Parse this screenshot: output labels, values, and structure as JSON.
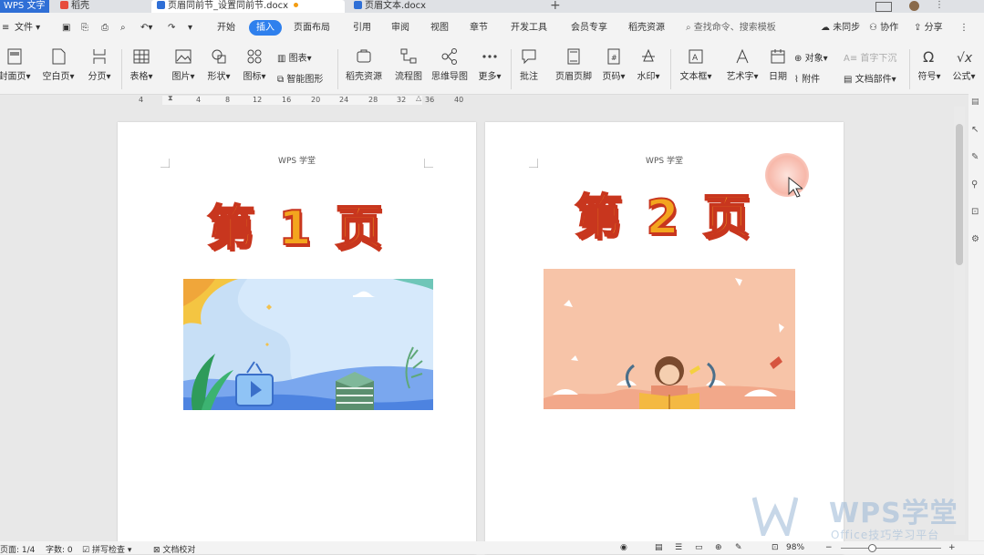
{
  "tabs": [
    {
      "label": "WPS 文字",
      "active": false
    },
    {
      "label": "稻壳",
      "active": false
    },
    {
      "label": "页眉同前节_设置同前节.docx",
      "active": true
    },
    {
      "label": "页眉文本.docx",
      "active": false
    }
  ],
  "menu": {
    "file": "文件",
    "items": [
      "开始",
      "插入",
      "页面布局",
      "引用",
      "审阅",
      "视图",
      "章节",
      "开发工具",
      "会员专享",
      "稻壳资源"
    ],
    "active": "插入",
    "search_placeholder": "查找命令、搜索模板",
    "unsynced": "未同步",
    "collab": "协作",
    "share": "分享"
  },
  "ribbon": {
    "cover": "封面页",
    "blank": "空白页",
    "pagebreak": "分页",
    "table": "表格",
    "picture": "图片",
    "shape": "形状",
    "icon": "图标",
    "chart": "图表",
    "smartart": "智能图形",
    "daoke_res": "稻壳资源",
    "flowchart": "流程图",
    "mindmap": "思维导图",
    "more": "更多",
    "comment": "批注",
    "header_footer": "页眉页脚",
    "page_number": "页码",
    "watermark": "水印",
    "textbox": "文本框",
    "wordart": "艺术字",
    "date": "日期",
    "object": "对象",
    "dropcap": "首字下沉",
    "attachment": "附件",
    "doc_parts": "文档部件",
    "symbol": "符号",
    "formula": "公式"
  },
  "ruler_marks": [
    "4",
    "",
    "4",
    "8",
    "12",
    "16",
    "20",
    "24",
    "28",
    "32",
    "36",
    "40"
  ],
  "pages": [
    {
      "header": "WPS 学堂",
      "title": "第 1 页"
    },
    {
      "header": "WPS 学堂",
      "title": "第 2 页"
    }
  ],
  "status": {
    "page": "页面: 1/4",
    "words": "字数: 0",
    "spellcheck": "拼写检查",
    "proofread": "文档校对",
    "zoom": "98%"
  },
  "watermark_brand": "WPS学堂",
  "watermark_sub": "Office技巧学习平台",
  "colors": {
    "accent": "#2f80ed",
    "title_fill": "#f3a51e",
    "title_outline": "#c8361e",
    "img1_bg": "#d6e9fb",
    "img2_bg": "#f7c4a8"
  }
}
